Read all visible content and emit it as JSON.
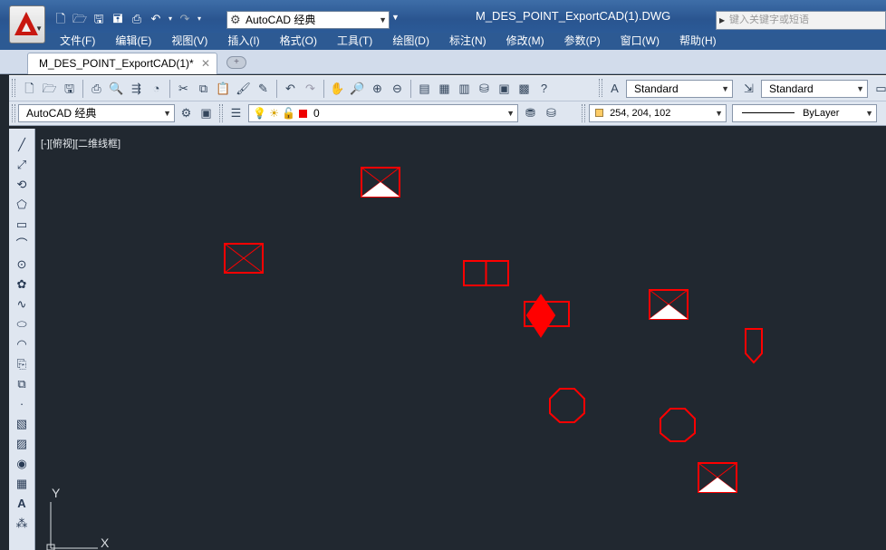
{
  "app": {
    "document_title": "M_DES_POINT_ExportCAD(1).DWG",
    "workspace": "AutoCAD 经典",
    "search_placeholder": "键入关键字或短语"
  },
  "menu": [
    "文件(F)",
    "编辑(E)",
    "视图(V)",
    "插入(I)",
    "格式(O)",
    "工具(T)",
    "绘图(D)",
    "标注(N)",
    "修改(M)",
    "参数(P)",
    "窗口(W)",
    "帮助(H)"
  ],
  "tabs": {
    "active": "M_DES_POINT_ExportCAD(1)*",
    "close": "✕",
    "new": "+"
  },
  "toolbar": {
    "text_style": "Standard",
    "dim_style": "Standard",
    "workspace_combo": "AutoCAD 经典",
    "layer": "0",
    "color": "254, 204, 102",
    "linetype": "ByLayer"
  },
  "colors": {
    "canvas": "#212830",
    "entity": "#ff0000",
    "layer_swatch": "#ee0000",
    "color_swatch": "#fecc66"
  },
  "viewport": {
    "label": "[-][俯视][二维线框]"
  },
  "ucs": {
    "x_label": "X",
    "y_label": "Y"
  }
}
